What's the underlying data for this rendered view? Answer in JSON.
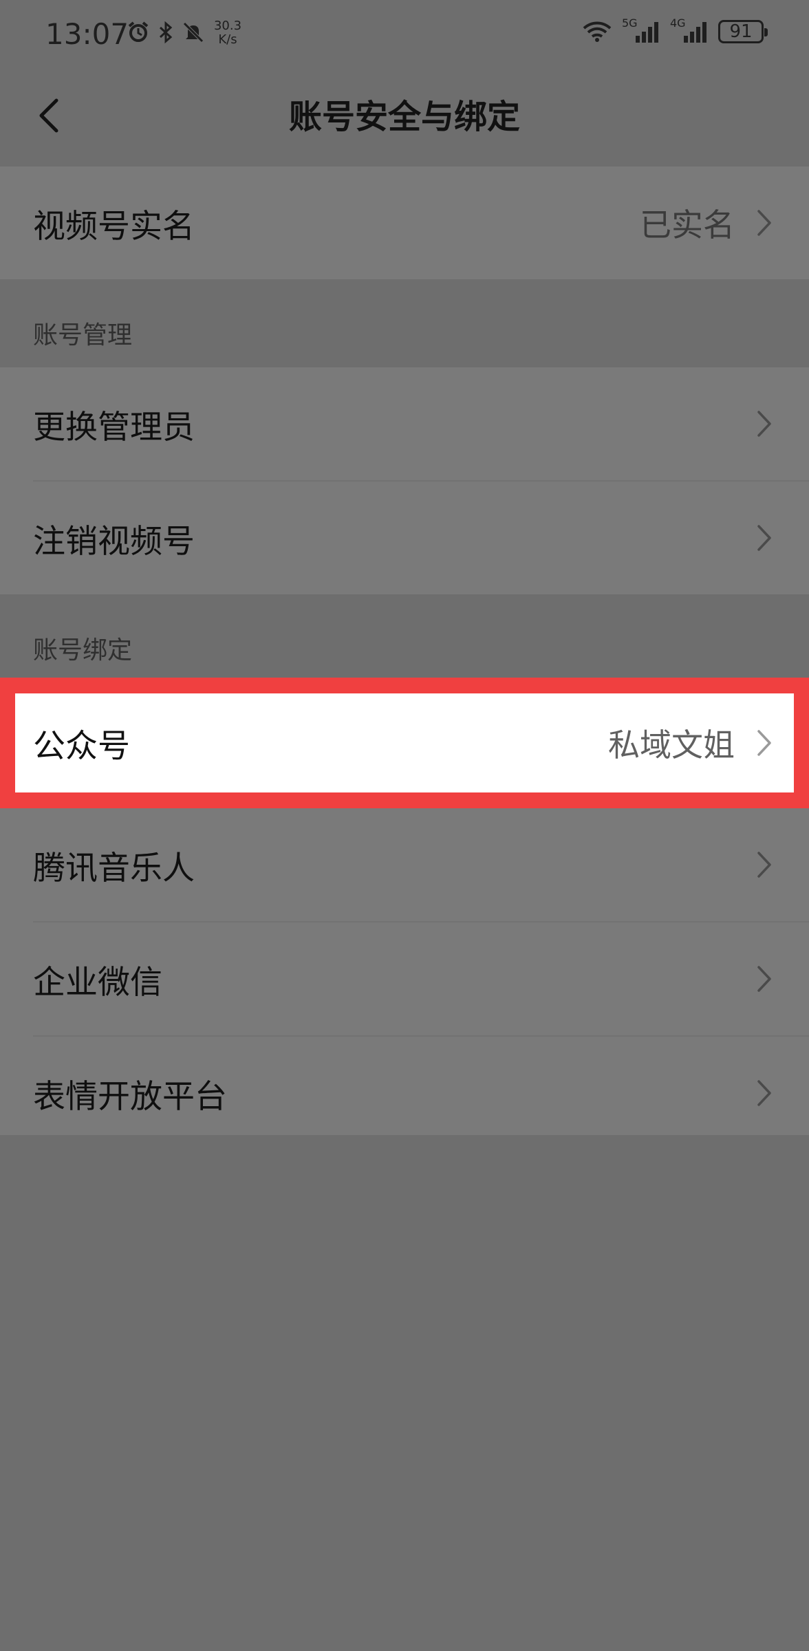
{
  "status_bar": {
    "time": "13:07",
    "net_speed_value": "30.3",
    "net_speed_unit": "K/s",
    "signal_5g": "5G",
    "signal_4g": "4G",
    "battery": "91"
  },
  "nav": {
    "title": "账号安全与绑定"
  },
  "realname": {
    "label": "视频号实名",
    "value": "已实名"
  },
  "account_management": {
    "header": "账号管理",
    "items": [
      {
        "label": "更换管理员"
      },
      {
        "label": "注销视频号"
      }
    ]
  },
  "account_binding": {
    "header": "账号绑定",
    "items": [
      {
        "label": "公众号",
        "value": "私域文姐"
      },
      {
        "label": "腾讯音乐人"
      },
      {
        "label": "企业微信"
      },
      {
        "label": "表情开放平台"
      }
    ]
  },
  "colors": {
    "highlight": "#f04040"
  }
}
